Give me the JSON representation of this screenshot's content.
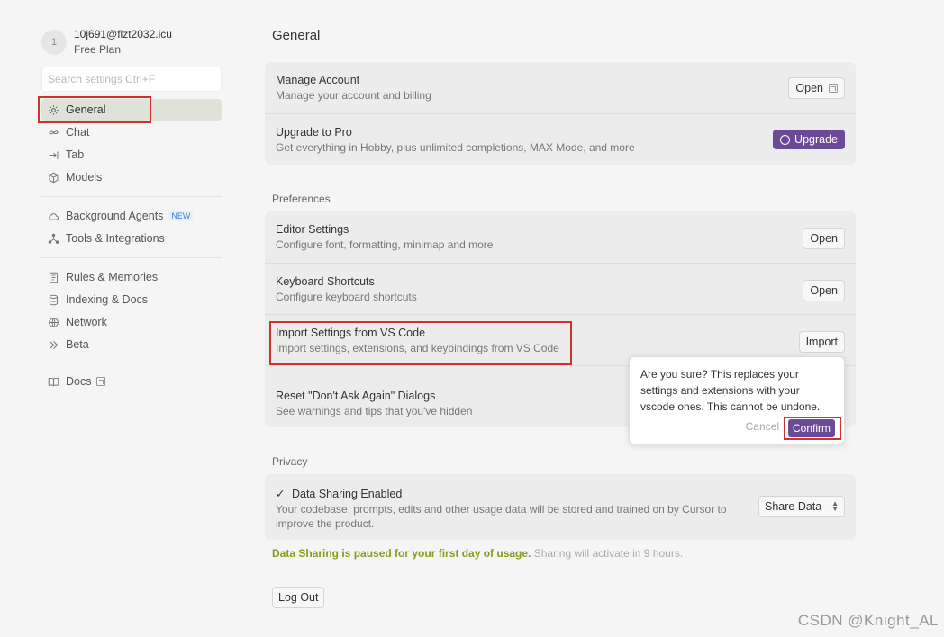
{
  "account": {
    "avatar_initial": "1",
    "email": "10j691@flzt2032.icu",
    "plan": "Free Plan"
  },
  "search": {
    "placeholder": "Search settings Ctrl+F"
  },
  "sidebar": {
    "items": [
      {
        "label": "General",
        "icon": "gear-icon"
      },
      {
        "label": "Chat",
        "icon": "infinity-icon"
      },
      {
        "label": "Tab",
        "icon": "tab-arrow-icon"
      },
      {
        "label": "Models",
        "icon": "cube-icon"
      },
      {
        "label": "Background Agents",
        "icon": "cloud-icon",
        "badge": "NEW"
      },
      {
        "label": "Tools & Integrations",
        "icon": "nodes-icon"
      },
      {
        "label": "Rules & Memories",
        "icon": "document-icon"
      },
      {
        "label": "Indexing & Docs",
        "icon": "database-icon"
      },
      {
        "label": "Network",
        "icon": "globe-icon"
      },
      {
        "label": "Beta",
        "icon": "double-chevron-icon"
      },
      {
        "label": "Docs",
        "icon": "book-icon"
      }
    ]
  },
  "main": {
    "title": "General",
    "account_card": {
      "manage": {
        "title": "Manage Account",
        "desc": "Manage your account and billing",
        "button": "Open"
      },
      "upgrade": {
        "title": "Upgrade to Pro",
        "desc": "Get everything in Hobby, plus unlimited completions, MAX Mode, and more",
        "button": "Upgrade"
      }
    },
    "preferences": {
      "label": "Preferences",
      "editor": {
        "title": "Editor Settings",
        "desc": "Configure font, formatting, minimap and more",
        "button": "Open"
      },
      "keyboard": {
        "title": "Keyboard Shortcuts",
        "desc": "Configure keyboard shortcuts",
        "button": "Open"
      },
      "import": {
        "title": "Import Settings from VS Code",
        "desc": "Import settings, extensions, and keybindings from VS Code",
        "button": "Import"
      },
      "reset": {
        "title": "Reset \"Don't Ask Again\" Dialogs",
        "desc": "See warnings and tips that you've hidden"
      }
    },
    "popover": {
      "message": "Are you sure? This replaces your settings and extensions with your vscode ones. This cannot be undone.",
      "cancel": "Cancel",
      "confirm": "Confirm"
    },
    "privacy": {
      "label": "Privacy",
      "checkmark": "✓",
      "title": "Data Sharing Enabled",
      "desc": "Your codebase, prompts, edits and other usage data will be stored and trained on by Cursor to improve the product.",
      "select_value": "Share Data"
    },
    "notice": {
      "strong": "Data Sharing is paused for your first day of usage.",
      "sub": "Sharing will activate in 9 hours."
    },
    "logout": "Log Out"
  },
  "watermark": "CSDN @Knight_AL",
  "colors": {
    "accent": "#6c4a96",
    "active_nav": "#dfe2d8",
    "highlight_box": "#d0312d",
    "notice": "#8a9a1a"
  }
}
